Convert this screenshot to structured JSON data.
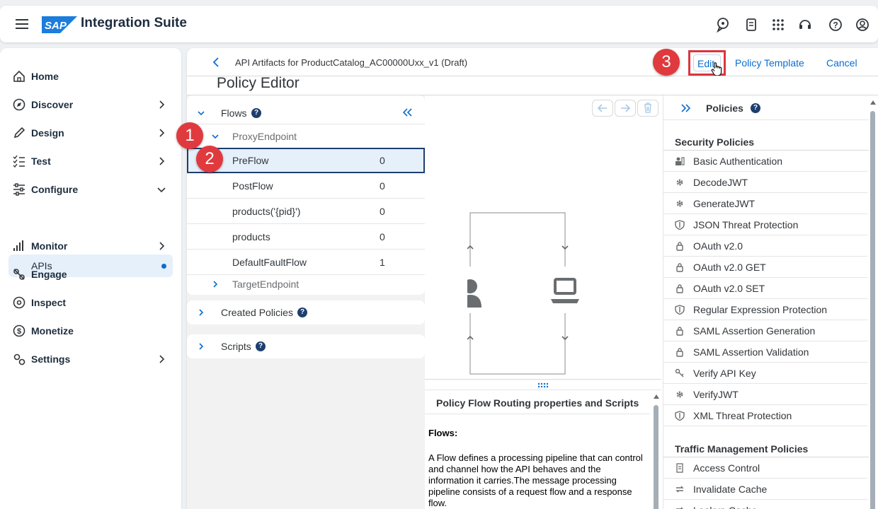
{
  "shell": {
    "logo_text": "SAP",
    "app_title": "Integration Suite",
    "icons": [
      "assistant-icon",
      "notifications-icon",
      "product-switch-icon",
      "support-icon",
      "help-icon",
      "user-icon"
    ]
  },
  "sidebar": {
    "items": [
      {
        "label": "Home",
        "icon": "home-icon",
        "chevron": ""
      },
      {
        "label": "Discover",
        "icon": "discover-icon",
        "chevron": "right"
      },
      {
        "label": "Design",
        "icon": "pencil-icon",
        "chevron": "right"
      },
      {
        "label": "Test",
        "icon": "checklist-icon",
        "chevron": "right"
      },
      {
        "label": "Configure",
        "icon": "sliders-icon",
        "chevron": "down"
      },
      {
        "label": "Monitor",
        "icon": "bar-chart-icon",
        "chevron": "right"
      },
      {
        "label": "Engage",
        "icon": "engage-icon",
        "chevron": ""
      },
      {
        "label": "Inspect",
        "icon": "inspect-icon",
        "chevron": ""
      },
      {
        "label": "Monetize",
        "icon": "dollar-icon",
        "chevron": ""
      },
      {
        "label": "Settings",
        "icon": "settings-icon",
        "chevron": "right"
      }
    ],
    "sub_item": {
      "label": "APIs"
    }
  },
  "header": {
    "breadcrumb": "API Artifacts for ProductCatalog_AC00000Uxx_v1 (Draft)",
    "edit_label": "Edit",
    "policy_template_label": "Policy Template",
    "cancel_label": "Cancel",
    "page_title": "Policy Editor"
  },
  "flows": {
    "title": "Flows",
    "proxy_endpoint": "ProxyEndpoint",
    "rows": [
      {
        "label": "PreFlow",
        "count": "0"
      },
      {
        "label": "PostFlow",
        "count": "0"
      },
      {
        "label": "products('{pid}')",
        "count": "0"
      },
      {
        "label": "products",
        "count": "0"
      },
      {
        "label": "DefaultFaultFlow",
        "count": "1"
      }
    ],
    "target_endpoint": "TargetEndpoint",
    "created_policies": "Created Policies",
    "scripts": "Scripts"
  },
  "info": {
    "title": "Policy Flow Routing properties and Scripts",
    "subtitle": "Flows:",
    "text": "A Flow defines a processing pipeline that can control and channel how the API behaves and the information it carries.The message processing pipeline consists of a request flow and a response flow."
  },
  "policies": {
    "title": "Policies",
    "security_title": "Security Policies",
    "security": [
      {
        "label": "Basic Authentication",
        "icon": "user-key-icon"
      },
      {
        "label": "DecodeJWT",
        "icon": "gear-icon"
      },
      {
        "label": "GenerateJWT",
        "icon": "gear-icon"
      },
      {
        "label": "JSON Threat Protection",
        "icon": "shield-icon"
      },
      {
        "label": "OAuth v2.0",
        "icon": "lock-icon"
      },
      {
        "label": "OAuth v2.0 GET",
        "icon": "lock-icon"
      },
      {
        "label": "OAuth v2.0 SET",
        "icon": "lock-icon"
      },
      {
        "label": "Regular Expression Protection",
        "icon": "shield-icon"
      },
      {
        "label": "SAML Assertion Generation",
        "icon": "lock-icon"
      },
      {
        "label": "SAML Assertion Validation",
        "icon": "lock-icon"
      },
      {
        "label": "Verify API Key",
        "icon": "key-icon"
      },
      {
        "label": "VerifyJWT",
        "icon": "gear-icon"
      },
      {
        "label": "XML Threat Protection",
        "icon": "shield-icon"
      }
    ],
    "traffic_title": "Traffic Management Policies",
    "traffic": [
      {
        "label": "Access Control",
        "icon": "document-icon"
      },
      {
        "label": "Invalidate Cache",
        "icon": "refresh-icon"
      },
      {
        "label": "Lookup Cache",
        "icon": "refresh-icon"
      }
    ]
  },
  "callouts": [
    "1",
    "2",
    "3"
  ],
  "colors": {
    "accent": "#0a6ed1",
    "callout": "#e03a3e",
    "selected_bg": "#e5f0fa"
  }
}
